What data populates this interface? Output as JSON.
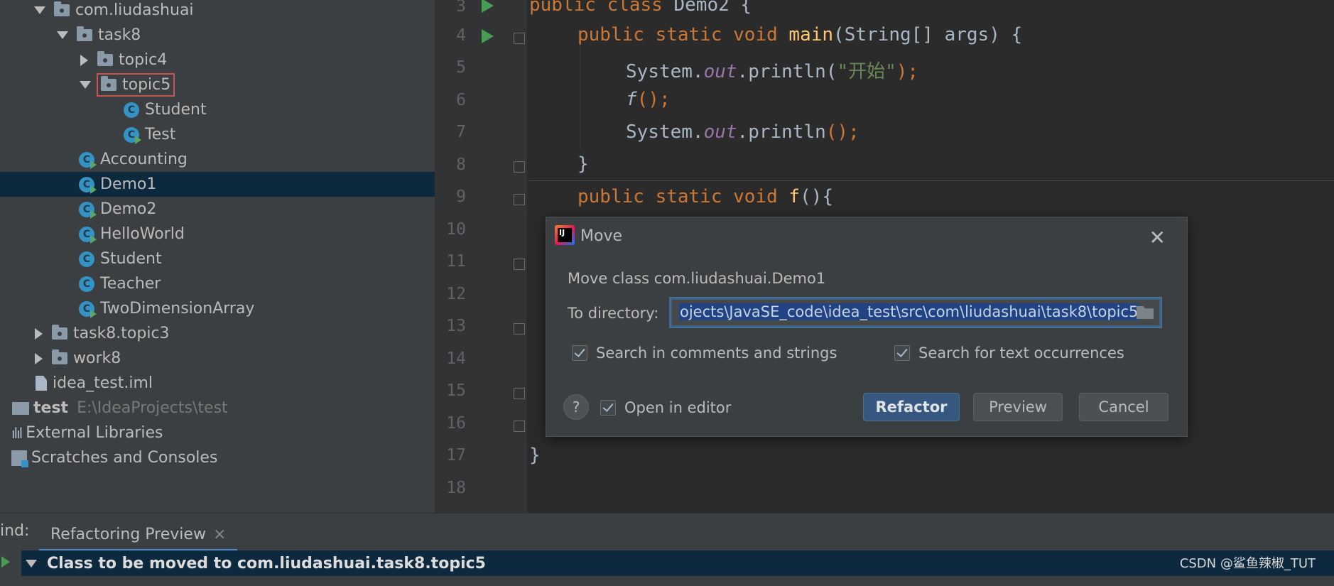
{
  "tree": [
    {
      "label": "com.liudashuai"
    },
    {
      "label": "task8"
    },
    {
      "label": "topic4"
    },
    {
      "label": "topic5"
    },
    {
      "label": "Student"
    },
    {
      "label": "Test"
    },
    {
      "label": "Accounting"
    },
    {
      "label": "Demo1"
    },
    {
      "label": "Demo2"
    },
    {
      "label": "HelloWorld"
    },
    {
      "label": "Student"
    },
    {
      "label": "Teacher"
    },
    {
      "label": "TwoDimensionArray"
    },
    {
      "label": "task8.topic3"
    },
    {
      "label": "work8"
    },
    {
      "label": "idea_test.iml"
    },
    {
      "label": "test",
      "path": "E:\\IdeaProjects\\test"
    },
    {
      "label": "External Libraries"
    },
    {
      "label": "Scratches and Consoles"
    }
  ],
  "class_icon_letter": "C",
  "line_numbers": [
    "3",
    "4",
    "5",
    "6",
    "7",
    "8",
    "9",
    "10",
    "11",
    "12",
    "13",
    "14",
    "15",
    "16",
    "17",
    "18"
  ],
  "code": {
    "l3": {
      "kw": "public class ",
      "name": "Demo2",
      "rest": " {"
    },
    "l4": {
      "kw": "public static void ",
      "fn": "main",
      "rest": "(String[] args) {"
    },
    "l5": {
      "pre": "System.",
      "field": "out",
      "mid": ".println(",
      "str": "\"开始\"",
      "rest": ");"
    },
    "l6": {
      "fn": "f",
      "rest": "();"
    },
    "l7": {
      "pre": "System.",
      "field": "out",
      "mid": ".println",
      "rest": "();"
    },
    "l8": "}",
    "l9": {
      "kw": "public static void ",
      "fn": "f",
      "rest": "(){"
    },
    "l17": "}"
  },
  "dialog": {
    "title": "Move",
    "close": "✕",
    "message": "Move class com.liudashuai.Demo1",
    "dir_label": "To directory:",
    "dir_value": "ojects\\JavaSE_code\\idea_test\\src\\com\\liudashuai\\task8\\topic5",
    "opt_comments": "Search in comments and strings",
    "opt_text": "Search for text occurrences",
    "opt_open": "Open in editor",
    "help": "?",
    "btn_refactor": "Refactor",
    "btn_preview": "Preview",
    "btn_cancel": "Cancel"
  },
  "bottom": {
    "find_label": "ind:",
    "tab_label": "Refactoring Preview",
    "tab_close": "×",
    "result": "Class to be moved to com.liudashuai.task8.topic5",
    "watermark": "CSDN @鲨鱼辣椒_TUT"
  },
  "colors": {
    "selection": "#0d293e",
    "accent": "#365880",
    "keyword": "#cc7832",
    "function": "#ffc66d",
    "string": "#6a8759"
  }
}
